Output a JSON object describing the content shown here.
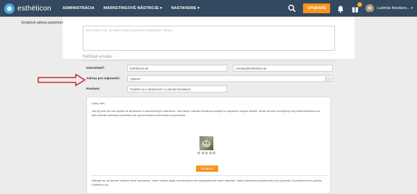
{
  "navbar": {
    "logo_text": "esthéticon",
    "menu": [
      {
        "label": "ADMINISTRÁCIA"
      },
      {
        "label": "MARKETINGOVÉ NÁSTROJE"
      },
      {
        "label": "NASTAVENIE"
      }
    ],
    "upgrade_label": "UPGRADE",
    "notification_count": "6",
    "user_name": "Ludmila Novákov...",
    "caret": "▾"
  },
  "form": {
    "patients_label": "Emailové adresy pacientov",
    "patients_placeholder": "Sem vložte max. 20 adries Vašich pacientov oddelených čiarkou",
    "preview_heading": "Náhľad emailu",
    "sender_label": "Odosielateľ:",
    "sender_name": "Esthéticon.sk",
    "sender_email": "noreply@estheticon.sk",
    "reply_label": "Adresa pre odpoveďe:",
    "reply_value": "Vyberte",
    "subject_label": "Predmet:",
    "subject_value": "Podeľte sa o skúsenosť s Ludmila Nováková"
  },
  "email": {
    "greeting": "Dobrý deň,",
    "paragraph1": "radi by sme sa Vás opýtali na skúsenosť s uskutočneným zákrokom. Váš názor Ludmila Nováková použije ku zlepšeniu svojich služieb. Bude zároveň zverejnený na portáli Esthéticon.sk, kde pomôže ostatným pacientom pri výbere lekára či liečebného pracoviska.",
    "button_label": "Ohodnotiť",
    "paragraph2": "Nebojte sa, skúsenosť môžete vložiť anonymne. Vaše osobné údaje nezverejníme ani neposkytneme tretím stranám. Vaša hodnotenie poslúžia ako vzor pacientu S poslednom tím portálu Esthéticon.sk."
  },
  "colors": {
    "navbar_bg": "#33495f",
    "accent": "#f7941d",
    "arrow": "#c62828"
  },
  "icons": [
    "search-icon",
    "bell-icon",
    "gift-icon",
    "avatar",
    "arrow-annotation"
  ]
}
